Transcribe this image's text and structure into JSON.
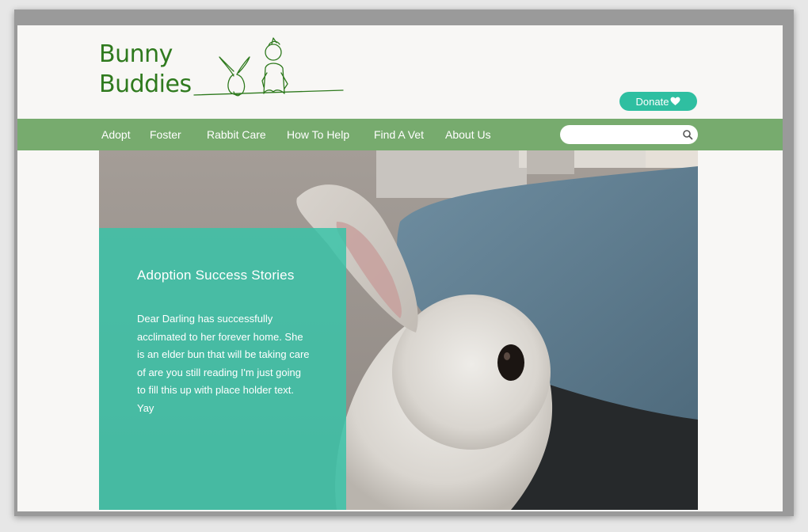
{
  "logo": {
    "line1": "Bunny",
    "line2": "Buddies"
  },
  "donate": {
    "label": "Donate",
    "icon": "heart-icon"
  },
  "nav": {
    "items": [
      {
        "label": "Adopt"
      },
      {
        "label": "Foster"
      },
      {
        "label": "Rabbit Care"
      },
      {
        "label": "How To Help"
      },
      {
        "label": "Find A Vet"
      },
      {
        "label": "About Us"
      }
    ]
  },
  "search": {
    "placeholder": "",
    "value": "",
    "icon": "search-icon"
  },
  "story": {
    "title": "Adoption Success Stories",
    "body": "Dear Darling has successfully acclimated to her forever home. She is an elder bun that will be taking care of are you still reading I'm just going to fill this up with place holder text. Yay"
  },
  "colors": {
    "brand_green": "#2f7a1e",
    "nav_green": "#77ab6e",
    "accent_teal": "#2fbfa1",
    "page_bg": "#f8f7f5"
  }
}
